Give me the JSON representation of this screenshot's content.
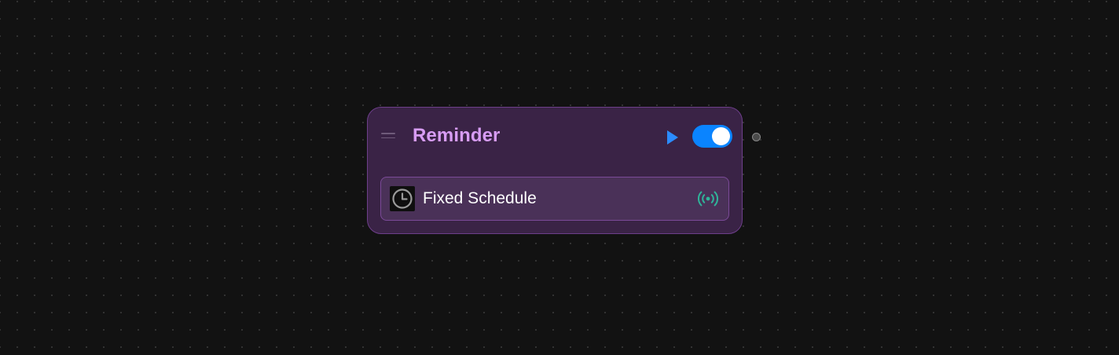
{
  "node": {
    "title": "Reminder",
    "enabled": true,
    "trigger": {
      "label": "Fixed Schedule",
      "icon": "clock-icon",
      "status_icon": "broadcast-icon"
    }
  },
  "icons": {
    "drag": "drag-handle-icon",
    "run": "play-icon",
    "output": "output-handle"
  },
  "colors": {
    "canvas": "#121212",
    "node_bg": "#3a2346",
    "node_border": "#6d3f8a",
    "title": "#d79cf4",
    "play": "#2b8cff",
    "toggle_on": "#0a84ff",
    "signal": "#2fb59a"
  }
}
